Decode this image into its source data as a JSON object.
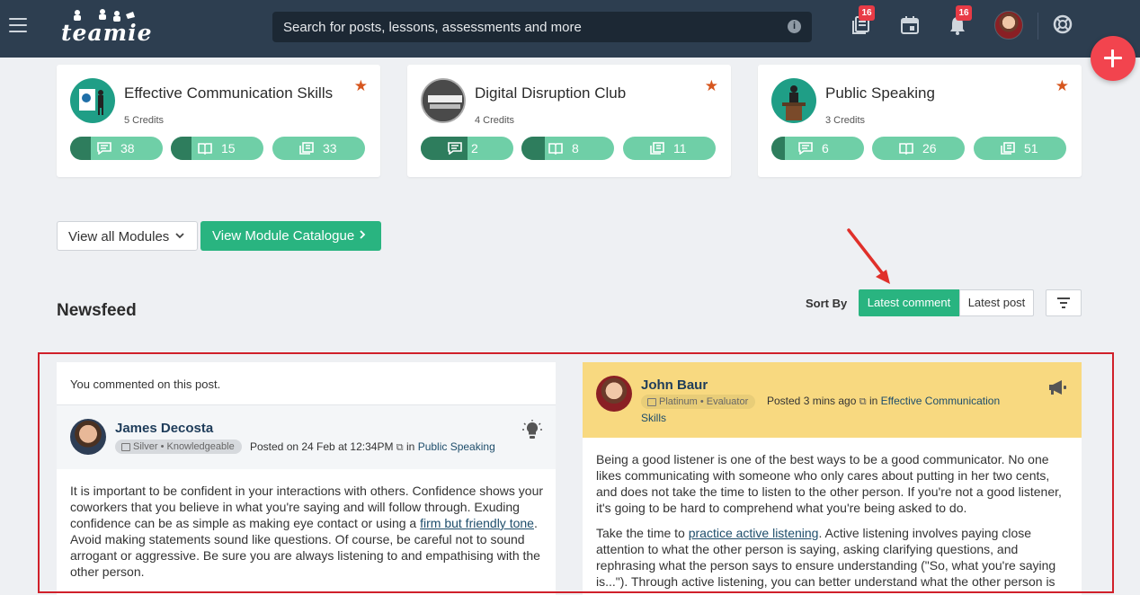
{
  "nav": {
    "logo_text": "teamie",
    "search_placeholder": "Search for posts, lessons, assessments and more",
    "info_glyph": "i",
    "badges": {
      "messages": "16",
      "notifications": "16"
    },
    "icons": [
      "menu-icon",
      "messages-icon",
      "calendar-icon",
      "bell-icon",
      "help-icon",
      "plus-icon"
    ]
  },
  "modules": [
    {
      "title": "Effective Communication Skills",
      "credits": "5 Credits",
      "counts": {
        "comments": "38",
        "lessons": "15",
        "assessments": "33"
      },
      "fills": [
        0.22,
        0.22,
        0
      ]
    },
    {
      "title": "Digital Disruption Club",
      "credits": "4 Credits",
      "counts": {
        "comments": "2",
        "lessons": "8",
        "assessments": "11"
      },
      "fills": [
        0.5,
        0.25,
        0
      ]
    },
    {
      "title": "Public Speaking",
      "credits": "3 Credits",
      "counts": {
        "comments": "6",
        "lessons": "26",
        "assessments": "51"
      },
      "fills": [
        0.15,
        0,
        0
      ]
    }
  ],
  "module_actions": {
    "view_all": "View all Modules",
    "catalogue": "View Module Catalogue"
  },
  "newsfeed": {
    "title": "Newsfeed",
    "sort_by": "Sort By",
    "sort_options": [
      "Latest comment",
      "Latest post"
    ],
    "active_sort": "Latest comment"
  },
  "posts": [
    {
      "note": "You commented on this post.",
      "author": "James Decosta",
      "tier": "Silver",
      "role": "Knowledgeable",
      "posted": "Posted on 24 Feb at 12:34PM",
      "in_label": "in",
      "module": "Public Speaking",
      "paragraphs": [
        {
          "before": "It is important to be confident in your interactions with others. Confidence shows your coworkers that you believe in what you're saying and will follow through. Exuding confidence can be as simple as making eye contact or using a ",
          "link": "firm but friendly tone",
          "after": ". Avoid making statements sound like questions. Of course, be careful not to sound arrogant or aggressive. Be sure you are always listening to and empathising with the other person."
        }
      ]
    },
    {
      "author": "John Baur",
      "tier": "Platinum",
      "role": "Evaluator",
      "posted": "Posted 3 mins ago",
      "in_label": "in",
      "module_part1": "Effective Communication",
      "module_part2": "Skills",
      "paragraphs": [
        {
          "text": "Being a good listener is one of the best ways to be a good communicator. No one likes communicating with someone who only cares about putting in her two cents, and does not take the time to listen to the other person. If you're not a good listener, it's going to be hard to comprehend what you're being asked to do."
        },
        {
          "before": "Take the time to ",
          "link": "practice active listening",
          "after": ". Active listening involves paying close attention to what the other person is saying, asking clarifying questions, and rephrasing what the person says to ensure understanding (\"So, what you're saying is...\"). Through active listening, you can better understand what the other person is"
        }
      ]
    }
  ],
  "colors": {
    "nav_bg": "#2d3e50",
    "accent_green": "#29b480",
    "pill_green": "#6fcfa7",
    "pill_dark": "#2e7d5d",
    "star": "#d6561e",
    "fab": "#f2444e",
    "highlight": "#d0202a",
    "announcement_bg": "#f8d980"
  }
}
